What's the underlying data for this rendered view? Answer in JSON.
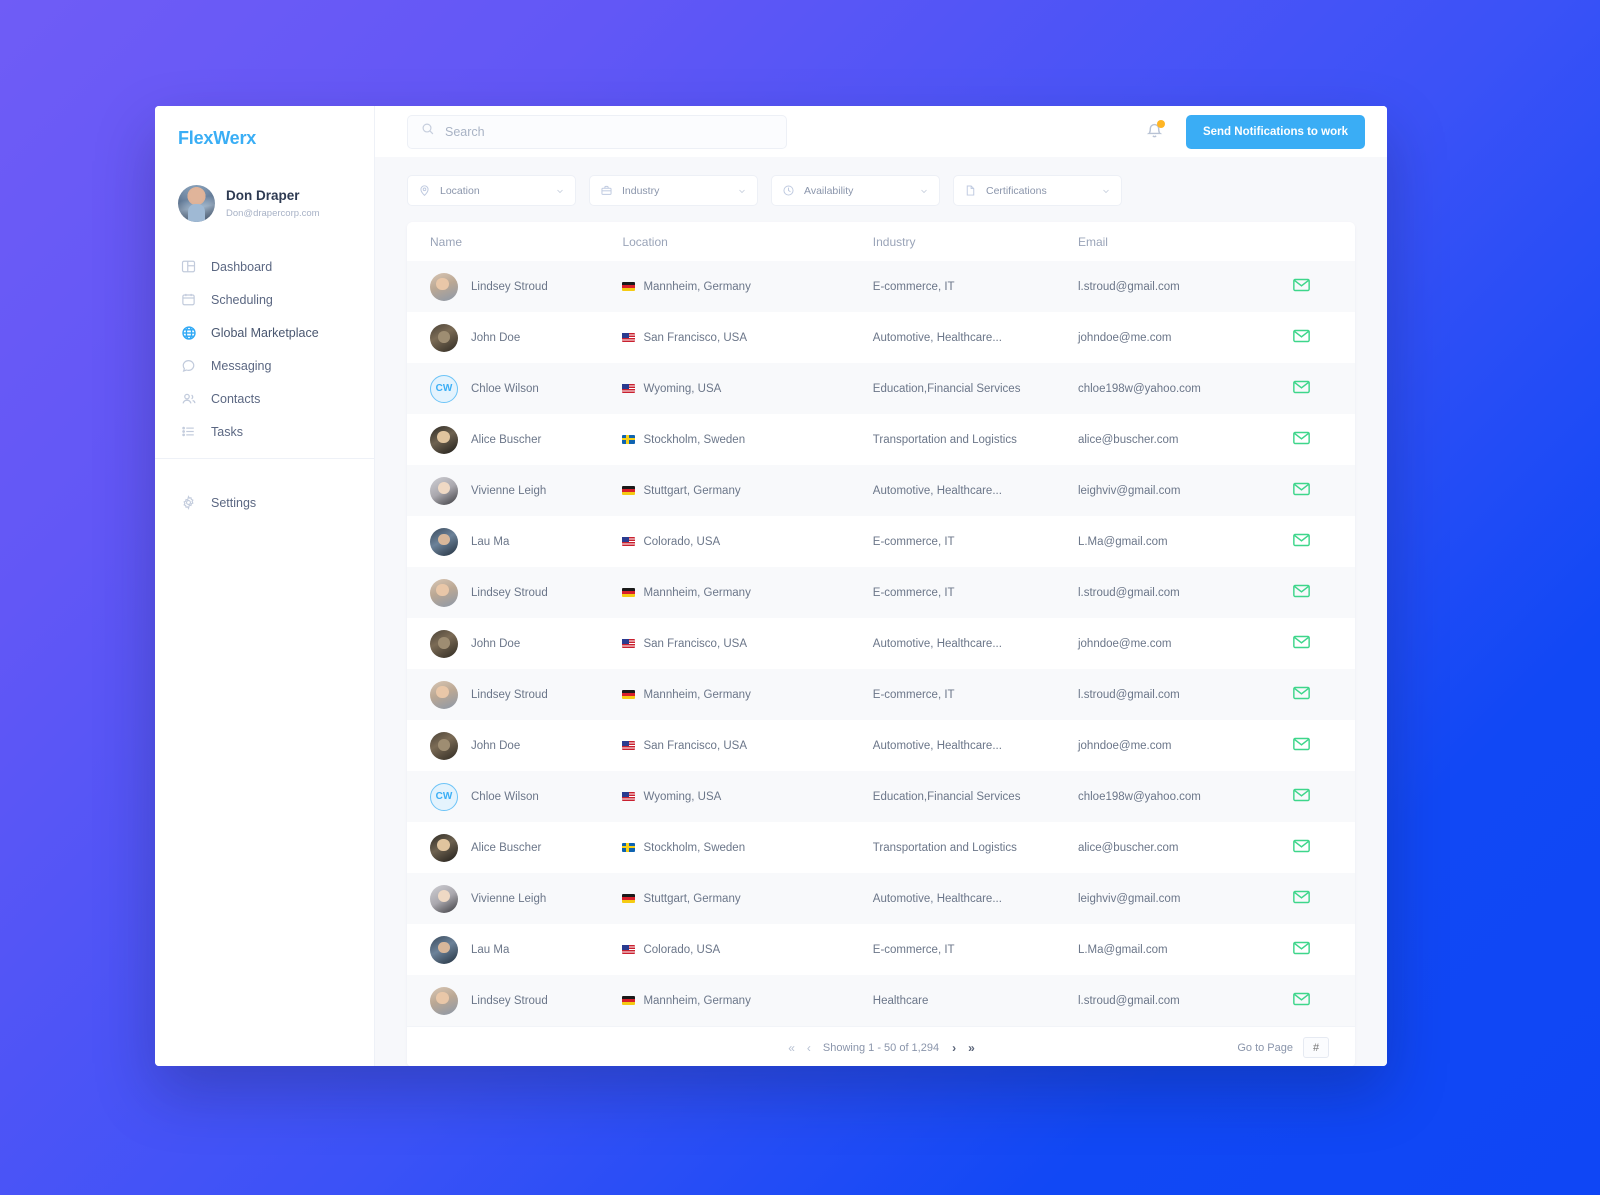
{
  "brand": {
    "name": "FlexWerx"
  },
  "profile": {
    "name": "Don Draper",
    "email": "Don@drapercorp.com",
    "avatar_icon": "user-photo"
  },
  "sidebar": {
    "items": [
      {
        "label": "Dashboard",
        "icon": "dashboard-icon",
        "active": false
      },
      {
        "label": "Scheduling",
        "icon": "calendar-icon",
        "active": false
      },
      {
        "label": "Global Marketplace",
        "icon": "globe-icon",
        "active": true
      },
      {
        "label": "Messaging",
        "icon": "chat-icon",
        "active": false
      },
      {
        "label": "Contacts",
        "icon": "people-icon",
        "active": false
      },
      {
        "label": "Tasks",
        "icon": "list-icon",
        "active": false
      }
    ],
    "bottom": [
      {
        "label": "Settings",
        "icon": "gear-icon",
        "active": false
      }
    ]
  },
  "topbar": {
    "search": {
      "value": "",
      "placeholder": "Search",
      "icon": "search-icon"
    },
    "bell": {
      "icon": "bell-icon",
      "has_badge": true,
      "badge_color": "#FFB524"
    },
    "notify_button": {
      "label": "Send Notifications to work",
      "color": "#3AADF5"
    }
  },
  "filters": [
    {
      "label": "Location",
      "icon": "map-pin-icon",
      "chevron": "chevron-down-icon"
    },
    {
      "label": "Industry",
      "icon": "briefcase-icon",
      "chevron": "chevron-down-icon"
    },
    {
      "label": "Availability",
      "icon": "clock-icon",
      "chevron": "chevron-down-icon"
    },
    {
      "label": "Certifications",
      "icon": "document-icon",
      "chevron": "chevron-down-icon"
    }
  ],
  "table": {
    "columns": [
      "Name",
      "Location",
      "Industry",
      "Email"
    ],
    "action_icon": "envelope-icon",
    "action_color": "#3ED68B",
    "rows": [
      {
        "name": "Lindsey Stroud",
        "avatar": "photo",
        "avatar_class": "p-lindsey",
        "location": "Mannheim, Germany",
        "flag": "de",
        "industry": "E-commerce, IT",
        "email": "l.stroud@gmail.com"
      },
      {
        "name": "John Doe",
        "avatar": "photo",
        "avatar_class": "p-john",
        "location": "San Francisco, USA",
        "flag": "us",
        "industry": "Automotive, Healthcare...",
        "email": "johndoe@me.com"
      },
      {
        "name": "Chloe Wilson",
        "avatar": "initials",
        "initials": "CW",
        "location": "Wyoming, USA",
        "flag": "us",
        "industry": "Education,Financial Services",
        "email": "chloe198w@yahoo.com"
      },
      {
        "name": "Alice Buscher",
        "avatar": "photo",
        "avatar_class": "p-alice",
        "location": "Stockholm, Sweden",
        "flag": "se",
        "industry": "Transportation and Logistics",
        "email": "alice@buscher.com"
      },
      {
        "name": "Vivienne Leigh",
        "avatar": "photo",
        "avatar_class": "p-vivienne",
        "location": "Stuttgart, Germany",
        "flag": "de",
        "industry": "Automotive, Healthcare...",
        "email": "leighviv@gmail.com"
      },
      {
        "name": "Lau Ma",
        "avatar": "photo",
        "avatar_class": "p-lau",
        "location": "Colorado, USA",
        "flag": "us",
        "industry": "E-commerce, IT",
        "email": "L.Ma@gmail.com"
      },
      {
        "name": "Lindsey Stroud",
        "avatar": "photo",
        "avatar_class": "p-lindsey",
        "location": "Mannheim, Germany",
        "flag": "de",
        "industry": "E-commerce, IT",
        "email": "l.stroud@gmail.com"
      },
      {
        "name": "John Doe",
        "avatar": "photo",
        "avatar_class": "p-john",
        "location": "San Francisco, USA",
        "flag": "us",
        "industry": "Automotive, Healthcare...",
        "email": "johndoe@me.com"
      },
      {
        "name": "Lindsey Stroud",
        "avatar": "photo",
        "avatar_class": "p-lindsey",
        "location": "Mannheim, Germany",
        "flag": "de",
        "industry": "E-commerce, IT",
        "email": "l.stroud@gmail.com"
      },
      {
        "name": "John Doe",
        "avatar": "photo",
        "avatar_class": "p-john",
        "location": "San Francisco, USA",
        "flag": "us",
        "industry": "Automotive, Healthcare...",
        "email": "johndoe@me.com"
      },
      {
        "name": "Chloe Wilson",
        "avatar": "initials",
        "initials": "CW",
        "location": "Wyoming, USA",
        "flag": "us",
        "industry": "Education,Financial Services",
        "email": "chloe198w@yahoo.com"
      },
      {
        "name": "Alice Buscher",
        "avatar": "photo",
        "avatar_class": "p-alice",
        "location": "Stockholm, Sweden",
        "flag": "se",
        "industry": "Transportation and Logistics",
        "email": "alice@buscher.com"
      },
      {
        "name": "Vivienne Leigh",
        "avatar": "photo",
        "avatar_class": "p-vivienne",
        "location": "Stuttgart, Germany",
        "flag": "de",
        "industry": "Automotive, Healthcare...",
        "email": "leighviv@gmail.com"
      },
      {
        "name": "Lau Ma",
        "avatar": "photo",
        "avatar_class": "p-lau",
        "location": "Colorado, USA",
        "flag": "us",
        "industry": "E-commerce, IT",
        "email": "L.Ma@gmail.com"
      },
      {
        "name": "Lindsey Stroud",
        "avatar": "photo",
        "avatar_class": "p-lindsey",
        "location": "Mannheim, Germany",
        "flag": "de",
        "industry": "Healthcare",
        "email": "l.stroud@gmail.com"
      }
    ]
  },
  "pagination": {
    "first_label": "«",
    "prev_label": "‹",
    "info": "Showing 1 - 50 of 1,294",
    "next_label": "›",
    "last_label": "»",
    "goto_label": "Go to Page",
    "goto_value": "",
    "goto_placeholder": "#"
  }
}
